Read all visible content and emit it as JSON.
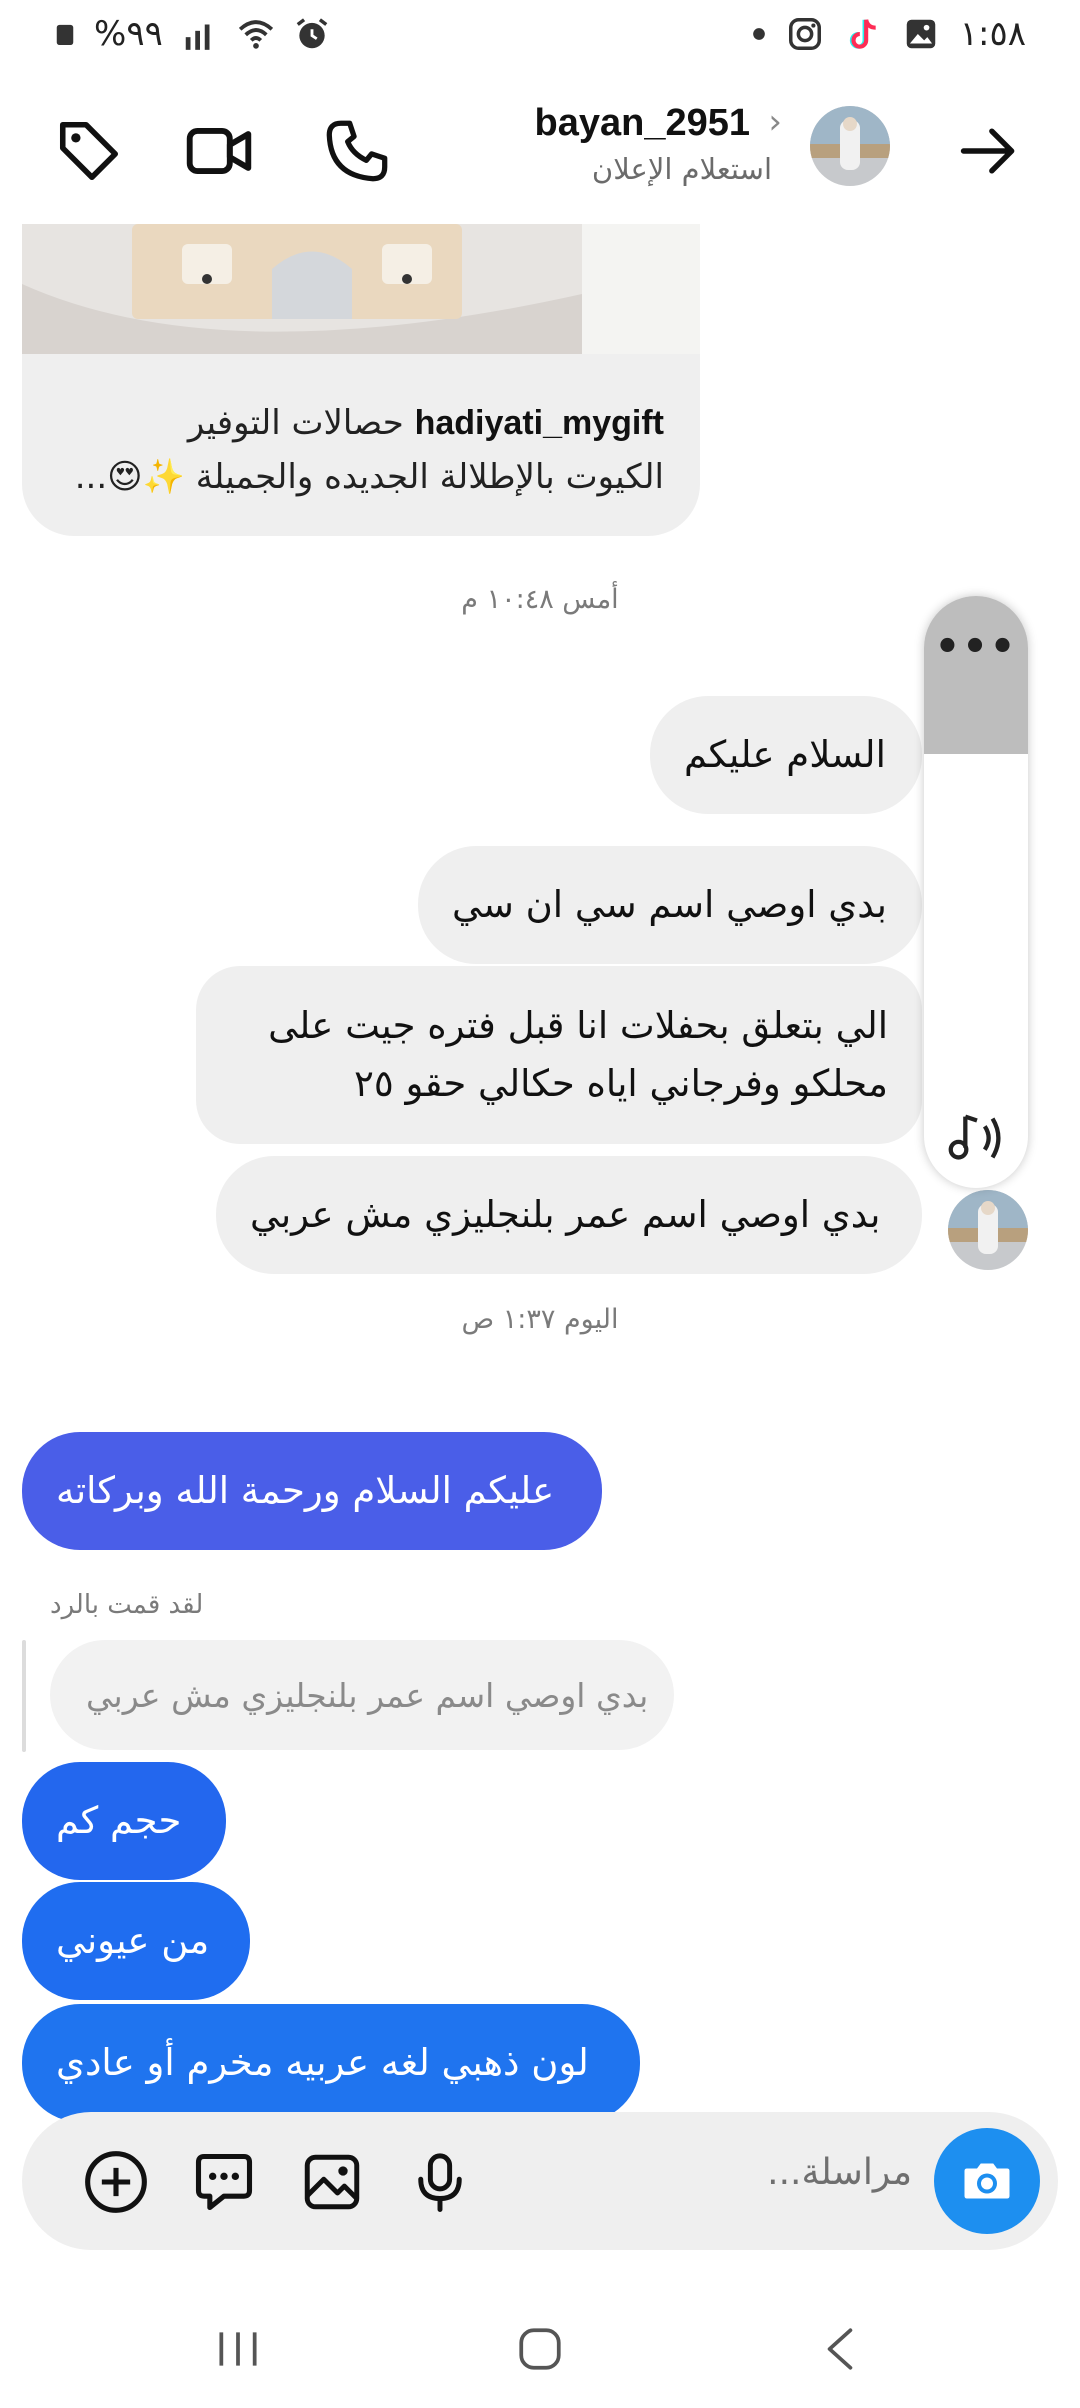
{
  "status_bar": {
    "battery": "%٩٩",
    "time": "١:٥٨"
  },
  "header": {
    "username": "bayan_2951",
    "subtitle": "استعلام الإعلان"
  },
  "post": {
    "account": "hadiyati_mygift",
    "line1_rest": "حصالات التوفير",
    "line2": "الكيوت بالإطلالة الجديده والجميلة ✨😍..."
  },
  "messages": {
    "timestamp_yesterday": "أمس ١٠:٤٨ م",
    "in_1": "السلام عليكم",
    "in_2": "بدي اوصي اسم سي ان سي",
    "in_3": "الي بتعلق بحفلات انا قبل فتره جيت على محلكو وفرجاني اياه حكالي حقو ٢٥",
    "in_4": "بدي اوصي اسم عمر بلنجليزي مش عربي",
    "timestamp_today": "اليوم ١:٣٧ ص",
    "out_1": "عليكم السلام ورحمة الله وبركاته",
    "reply_label": "لقد قمت بالرد",
    "reply_quote": "بدي اوصي اسم عمر بلنجليزي مش عربي",
    "out_2": "حجم كم",
    "out_3": "من عيوني",
    "out_4": "لون ذهبي لغه عربيه مخرم أو عادي"
  },
  "overlay_panel": {
    "dots": "•••"
  },
  "composer": {
    "placeholder": "مراسلة..."
  },
  "colors": {
    "out_bubble_first": "#4a5ee8",
    "out_bubble_rest": "#1f74ef",
    "in_bubble": "#efefef",
    "camera_button": "#1d8ff0"
  }
}
